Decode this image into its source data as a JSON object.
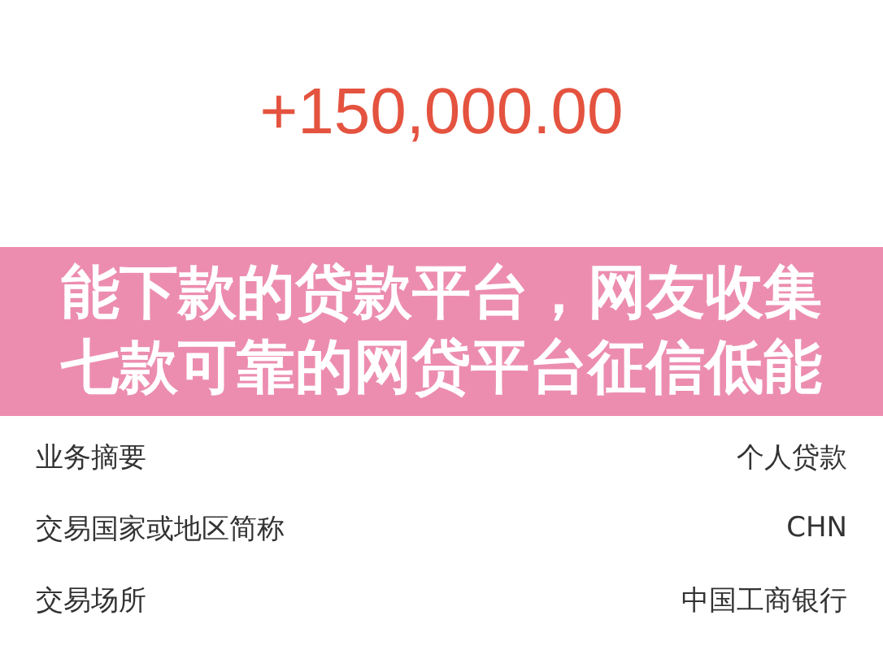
{
  "amount": "+150,000.00",
  "banner": {
    "lines": [
      "能下款的贷款平台，网友收集",
      "七款可靠的网贷平台征信低能"
    ]
  },
  "rows": [
    {
      "label": "业务摘要",
      "value": "个人贷款"
    },
    {
      "label": "交易国家或地区简称",
      "value": "CHN"
    },
    {
      "label": "交易场所",
      "value": "中国工商银行"
    }
  ]
}
